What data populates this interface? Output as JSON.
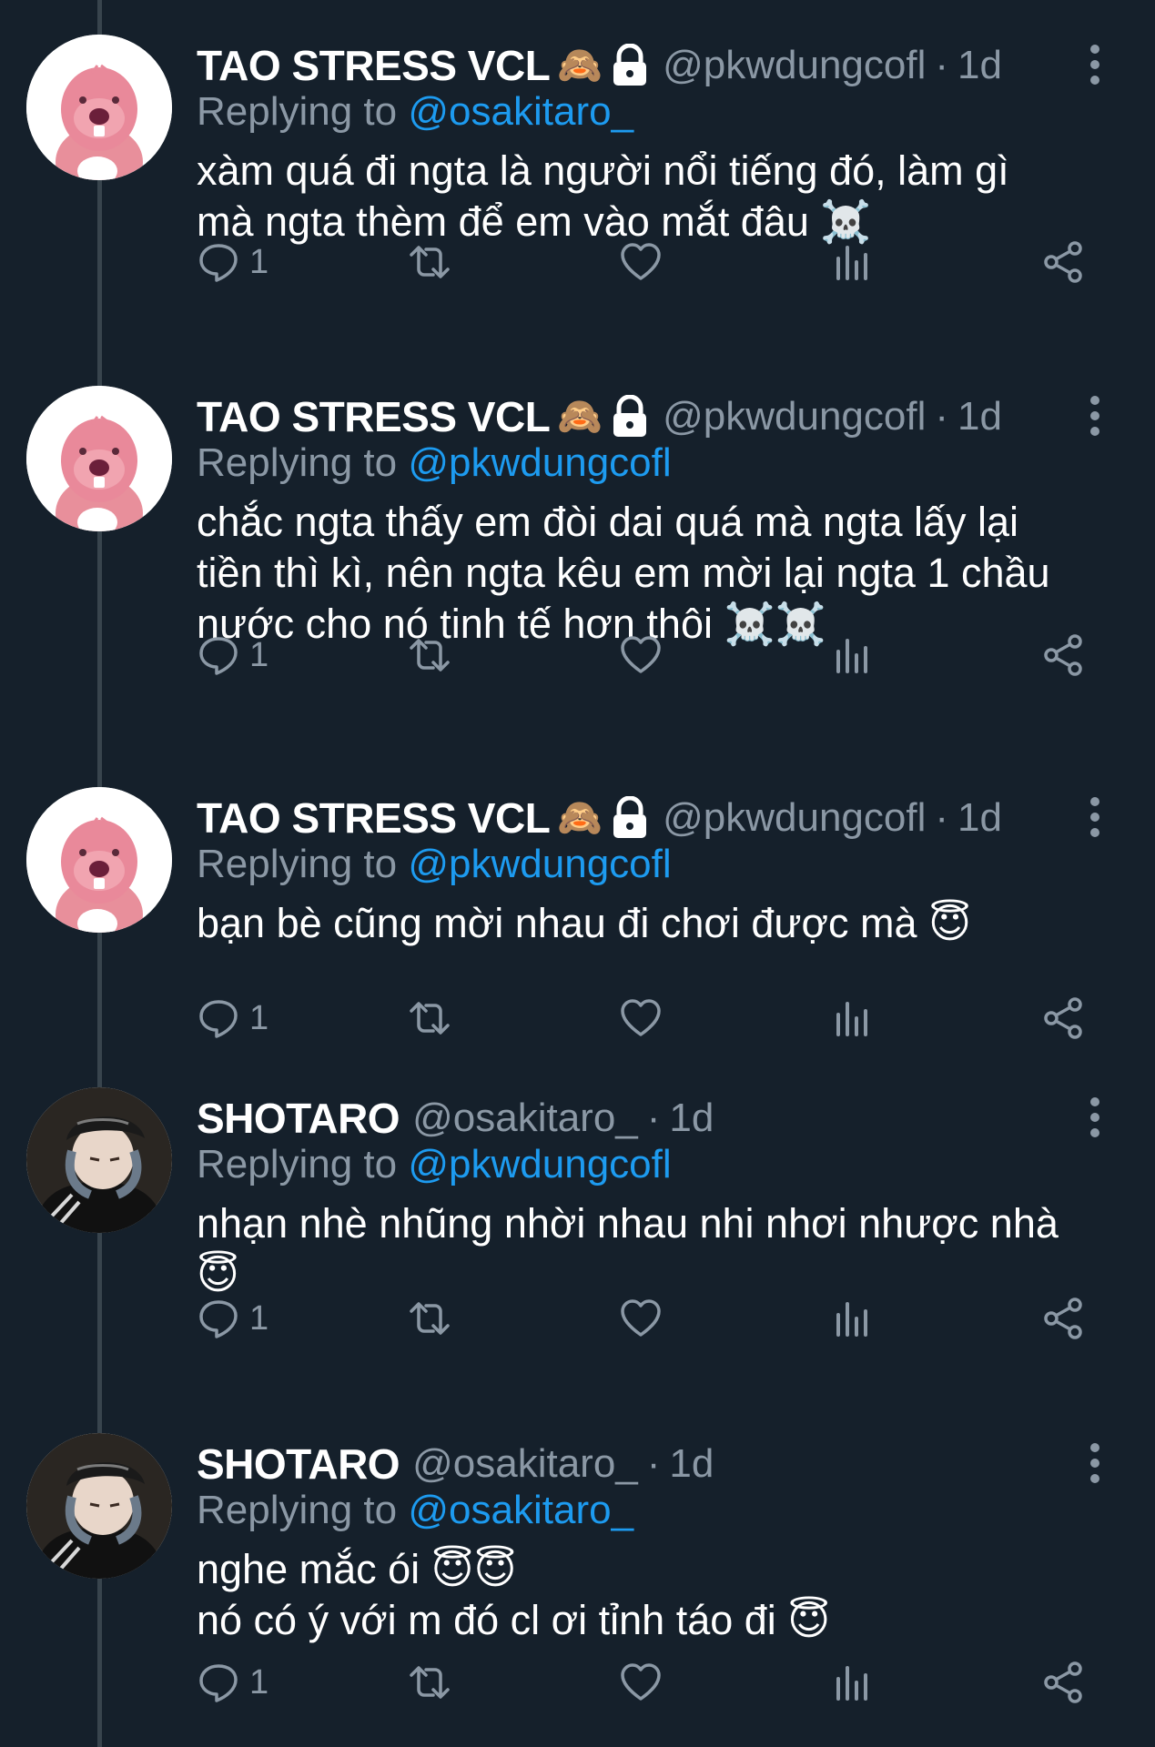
{
  "tweets": [
    {
      "name": "TAO STRESS VCL",
      "badge_emoji": "🙈",
      "handle": "@pkwdungcofl",
      "separator": "·",
      "time": "1d",
      "replying_prefix": "Replying to",
      "replying_to": "@osakitaro_",
      "body_lines": [
        "xàm quá đi ngta là người nổi tiếng đó, làm gì",
        "mà ngta thèm để em vào mắt đâu ☠️"
      ],
      "reply_count": "1",
      "avatar": "pink-beaver-avatar",
      "locked": true
    },
    {
      "name": "TAO STRESS VCL",
      "badge_emoji": "🙈",
      "handle": "@pkwdungcofl",
      "separator": "·",
      "time": "1d",
      "replying_prefix": "Replying to",
      "replying_to": "@pkwdungcofl",
      "body_lines": [
        "chắc ngta thấy em đòi dai quá mà ngta lấy lại",
        "tiền thì kì, nên ngta kêu em mời lại ngta 1 chầu",
        "nước cho nó tinh tế hơn thôi ☠️☠️"
      ],
      "reply_count": "1",
      "avatar": "pink-beaver-avatar",
      "locked": true
    },
    {
      "name": "TAO STRESS VCL",
      "badge_emoji": "🙈",
      "handle": "@pkwdungcofl",
      "separator": "·",
      "time": "1d",
      "replying_prefix": "Replying to",
      "replying_to": "@pkwdungcofl",
      "body_lines": [
        "bạn bè cũng mời nhau đi chơi được mà 😇"
      ],
      "reply_count": "1",
      "avatar": "pink-beaver-avatar",
      "locked": true
    },
    {
      "name": "SHOTARO",
      "badge_emoji": "",
      "handle": "@osakitaro_",
      "separator": "·",
      "time": "1d",
      "replying_prefix": "Replying to",
      "replying_to": "@pkwdungcofl",
      "body_lines": [
        "nhạn nhè nhũng nhời nhau nhi nhơi nhược nhà",
        "😇"
      ],
      "reply_count": "1",
      "avatar": "person-photo-avatar",
      "locked": false
    },
    {
      "name": "SHOTARO",
      "badge_emoji": "",
      "handle": "@osakitaro_",
      "separator": "·",
      "time": "1d",
      "replying_prefix": "Replying to",
      "replying_to": "@osakitaro_",
      "body_lines": [
        "nghe mắc ói 😇😇",
        "nó có ý với m đó cl ơi tỉnh táo đi 😇"
      ],
      "reply_count": "1",
      "avatar": "person-photo-avatar",
      "locked": false
    }
  ],
  "colors": {
    "background": "#15202b",
    "text": "#ffffff",
    "secondary": "#8b98a5",
    "mention": "#1d9bf0",
    "thread_line": "#38444d"
  },
  "icons": {
    "reply": "reply-bubble-icon",
    "retweet": "retweet-icon",
    "like": "heart-icon",
    "views": "bar-chart-icon",
    "share": "share-icon",
    "more": "more-vertical-icon",
    "lock": "lock-icon"
  }
}
